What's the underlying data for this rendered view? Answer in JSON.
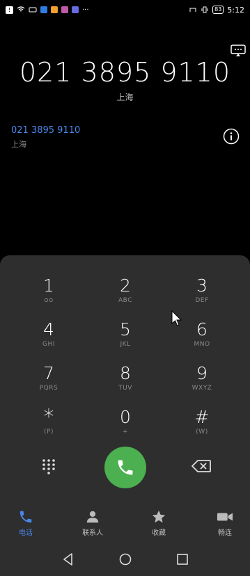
{
  "status": {
    "time": "5:12",
    "battery": "83",
    "more": "···"
  },
  "dialer": {
    "number": "021 3895 9110",
    "location": "上海",
    "suggestion": {
      "number": "021 3895 9110",
      "location": "上海"
    }
  },
  "keys": [
    {
      "digit": "1",
      "letters": "ᴑᴑ"
    },
    {
      "digit": "2",
      "letters": "ABC"
    },
    {
      "digit": "3",
      "letters": "DEF"
    },
    {
      "digit": "4",
      "letters": "GHI"
    },
    {
      "digit": "5",
      "letters": "JKL"
    },
    {
      "digit": "6",
      "letters": "MNO"
    },
    {
      "digit": "7",
      "letters": "PQRS"
    },
    {
      "digit": "8",
      "letters": "TUV"
    },
    {
      "digit": "9",
      "letters": "WXYZ"
    },
    {
      "digit": "*",
      "letters": "(P)"
    },
    {
      "digit": "0",
      "letters": "+"
    },
    {
      "digit": "#",
      "letters": "(W)"
    }
  ],
  "tabs": [
    {
      "label": "电话",
      "icon": "phone-icon",
      "active": true
    },
    {
      "label": "联系人",
      "icon": "contacts-icon",
      "active": false
    },
    {
      "label": "收藏",
      "icon": "star-icon",
      "active": false
    },
    {
      "label": "畅连",
      "icon": "video-icon",
      "active": false
    }
  ],
  "colors": {
    "accent": "#4a86e8",
    "call": "#4caf50",
    "keypad_bg": "#2e2e2e"
  }
}
